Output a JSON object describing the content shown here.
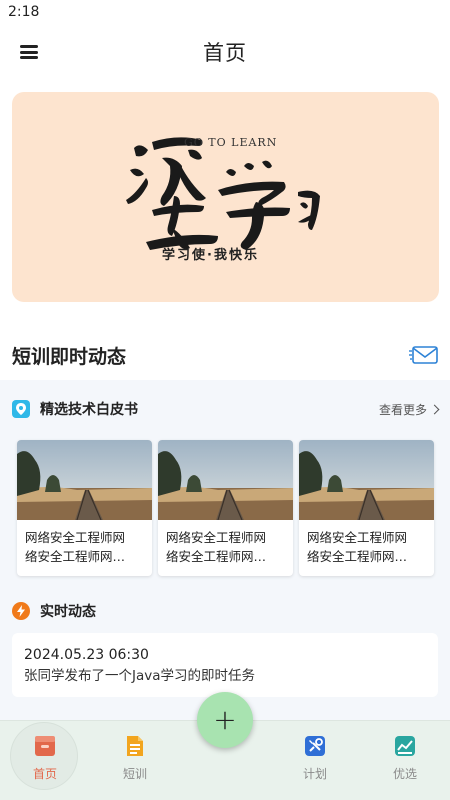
{
  "status_bar": {
    "time": "2:18"
  },
  "header": {
    "title": "首页",
    "menu_icon": "hamburger-menu-icon"
  },
  "banner": {
    "english_text": "GO TO LEARN",
    "slogan": "学习使·我快乐",
    "background": "#fde4cf"
  },
  "section": {
    "title": "短训即时动态",
    "icon": "mail-icon"
  },
  "whitepaper": {
    "title": "精选技术白皮书",
    "see_more": "查看更多",
    "icon": "location-badge-icon",
    "icon_color": "#2fb8e8",
    "cards": [
      {
        "line1": "网络安全工程师网",
        "line2": "络安全工程师网…"
      },
      {
        "line1": "网络安全工程师网",
        "line2": "络安全工程师网…"
      },
      {
        "line1": "网络安全工程师网",
        "line2": "络安全工程师网…"
      }
    ]
  },
  "realtime": {
    "title": "实时动态",
    "icon": "lightning-icon",
    "icon_color": "#f07a1a",
    "item": {
      "time": "2024.05.23 06:30",
      "message": "张同学发布了一个Java学习的即时任务"
    }
  },
  "tab_bar": {
    "tabs": [
      {
        "label": "首页",
        "icon": "home-box-icon",
        "color": "#e2684b",
        "active": true
      },
      {
        "label": "短训",
        "icon": "document-icon",
        "color": "#f2a51e",
        "active": false
      },
      {
        "label": "计划",
        "icon": "tools-icon",
        "color": "#2f6fd6",
        "active": false
      },
      {
        "label": "优选",
        "icon": "chart-icon",
        "color": "#2aa6a0",
        "active": false
      }
    ],
    "fab_label": "+"
  }
}
